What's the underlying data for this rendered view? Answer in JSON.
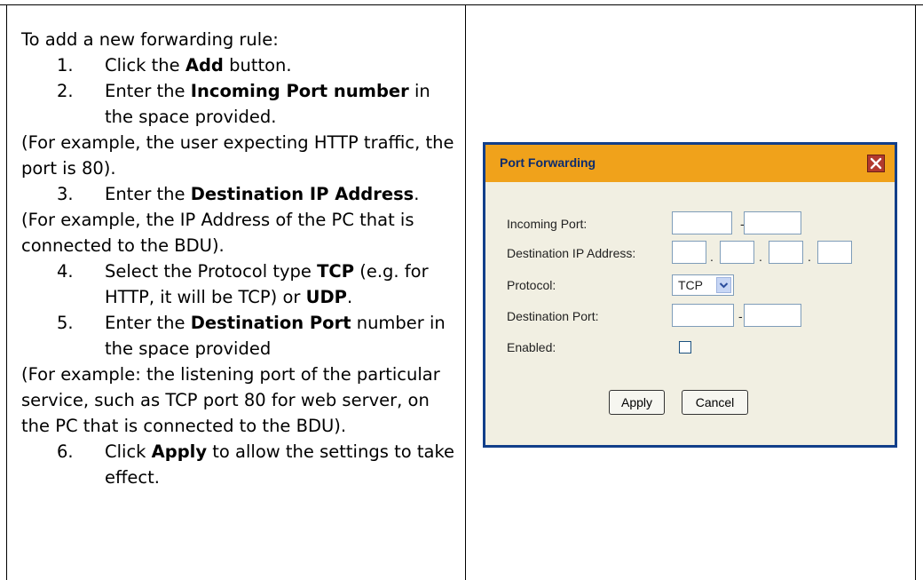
{
  "doc": {
    "intro": "To add a new forwarding rule:",
    "steps": [
      {
        "num": "1.",
        "pre": "Click the ",
        "bold": "Add",
        "post": " button."
      },
      {
        "num": "2.",
        "pre": "Enter the ",
        "bold": "Incoming Port number",
        "post": " in the space provided."
      },
      {
        "num": "3.",
        "pre": "Enter the ",
        "bold": "Destination IP Address",
        "post": "."
      },
      {
        "num": "4.",
        "pre": "Select the Protocol type ",
        "bold": "TCP",
        "mid": " (e.g. for HTTP, it will be TCP) or ",
        "bold2": "UDP",
        "post": "."
      },
      {
        "num": "5.",
        "pre": "Enter the ",
        "bold": "Destination Port",
        "post": " number in the space provided"
      },
      {
        "num": "6.",
        "pre": "Click ",
        "bold": "Apply",
        "post": " to allow the settings to take effect."
      }
    ],
    "notes": [
      "(For example, the user expecting HTTP traffic, the port is 80).",
      "(For example, the IP Address of the PC that is connected to the BDU).",
      "(For example: the listening port of the particular service, such as TCP port 80 for web server, on the PC that is connected to the BDU)."
    ]
  },
  "dialog": {
    "title": "Port Forwarding",
    "labels": {
      "incoming_port": "Incoming Port:",
      "destination_ip": "Destination IP Address:",
      "protocol": "Protocol:",
      "destination_port": "Destination Port:",
      "enabled": "Enabled:"
    },
    "protocol_value": "TCP",
    "separators": {
      "dash": "-",
      "dot": "."
    },
    "buttons": {
      "apply": "Apply",
      "cancel": "Cancel"
    }
  }
}
